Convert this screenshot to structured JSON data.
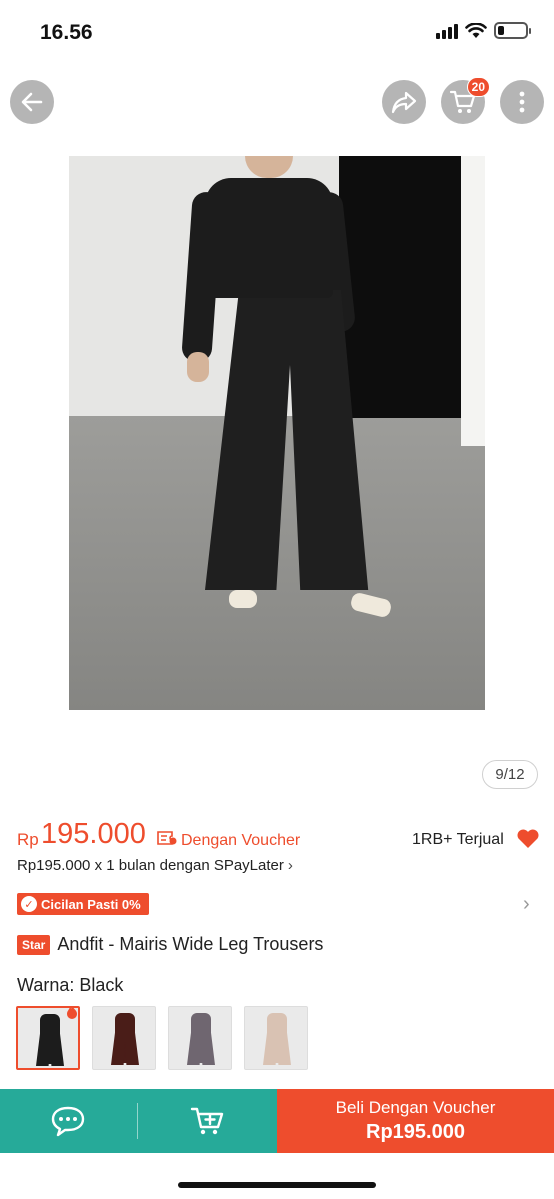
{
  "status_bar": {
    "time": "16.56"
  },
  "nav": {
    "cart_count": "20"
  },
  "gallery": {
    "counter": "9/12"
  },
  "price": {
    "currency": "Rp",
    "amount": "195.000",
    "voucher_label": "Dengan Voucher",
    "sold": "1RB+ Terjual"
  },
  "paylater": {
    "text": "Rp195.000 x 1 bulan dengan SPayLater",
    "chevron": "›"
  },
  "promo": {
    "cicilan": "Cicilan Pasti 0%"
  },
  "product": {
    "badge": "Star",
    "title": "Andfit - Mairis Wide Leg Trousers"
  },
  "variant": {
    "label": "Warna:",
    "value": "Black",
    "options": [
      {
        "color": "#1c1c1c",
        "selected": true
      },
      {
        "color": "#4a1d18",
        "selected": false
      },
      {
        "color": "#6f6670",
        "selected": false
      },
      {
        "color": "#d9c2b3",
        "selected": false
      }
    ]
  },
  "bottom_bar": {
    "buy_line1": "Beli Dengan Voucher",
    "buy_line2": "Rp195.000"
  },
  "colors": {
    "accent": "#ee4d2d",
    "secondary": "#26aa99"
  },
  "icons": [
    "back-arrow-icon",
    "share-icon",
    "cart-icon",
    "more-vertical-icon",
    "voucher-icon",
    "heart-icon",
    "chat-icon",
    "add-to-cart-icon",
    "flame-icon",
    "chevron-right-icon"
  ]
}
